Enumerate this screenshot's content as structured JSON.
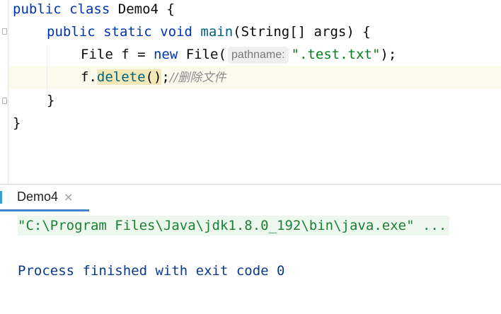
{
  "editor": {
    "lines": {
      "l1": {
        "kw1": "public",
        "kw2": "class",
        "rest": "Demo4 {"
      },
      "l2": {
        "kw1": "public",
        "kw2": "static",
        "kw3": "void",
        "fn": "main",
        "rest": "(String[] args) {"
      },
      "l3": {
        "pre": "File f = ",
        "kw": "new",
        "type": "File",
        "open": "(",
        "hint": "pathname:",
        "str": "\".test.txt\"",
        "close": ");"
      },
      "l4": {
        "obj": "f.",
        "method": "delete",
        "parens": "()",
        "semi": ";",
        "comment": "//删除文件"
      },
      "l5": {
        "brace": "}"
      },
      "l6": {
        "brace": "}"
      }
    }
  },
  "run_panel": {
    "tab_label": "Demo4",
    "close_glyph": "×",
    "console": {
      "command": "\"C:\\Program Files\\Java\\jdk1.8.0_192\\bin\\java.exe\" ...",
      "exit_message": "Process finished with exit code 0"
    }
  },
  "colors": {
    "keyword": "#0033b3",
    "string": "#067d17",
    "method": "#00627a",
    "comment": "#8c8c8c",
    "active_tab": "#4083c9"
  }
}
